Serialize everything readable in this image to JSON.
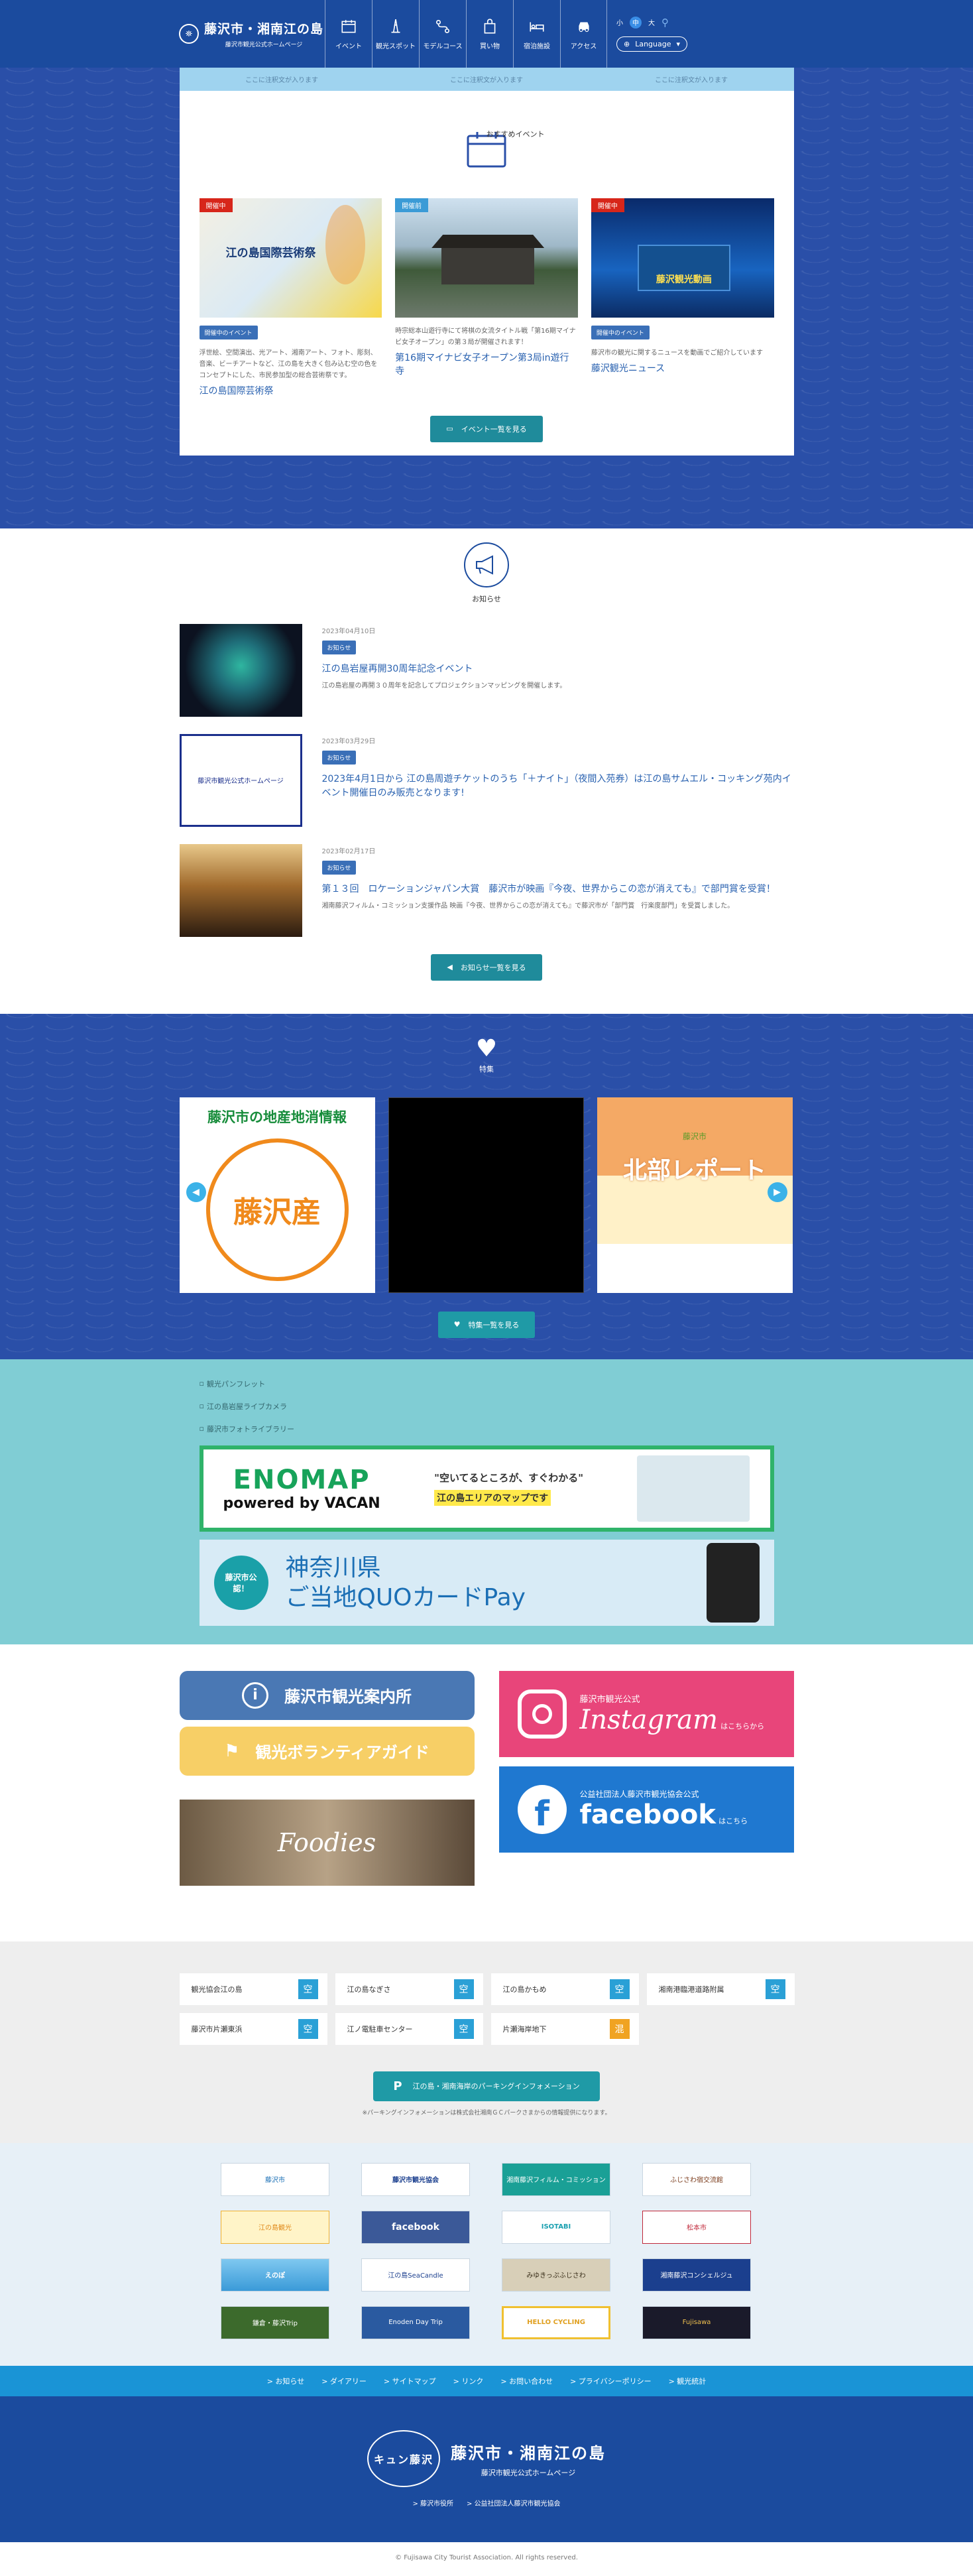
{
  "header": {
    "logo_title": "藤沢市・湘南江の島",
    "logo_sub": "藤沢市観光公式ホームページ",
    "nav": [
      {
        "label": "イベント",
        "icon": "calendar-icon"
      },
      {
        "label": "観光スポット",
        "icon": "tower-icon"
      },
      {
        "label": "モデルコース",
        "icon": "route-icon"
      },
      {
        "label": "買い物",
        "icon": "shopping-bag-icon"
      },
      {
        "label": "宿泊施設",
        "icon": "bed-icon"
      },
      {
        "label": "アクセス",
        "icon": "car-icon"
      }
    ],
    "font_sizes": [
      "小",
      "中",
      "大"
    ],
    "language_label": "Language"
  },
  "ticker": [
    "ここに注釈文が入ります",
    "ここに注釈文が入ります",
    "ここに注釈文が入ります"
  ],
  "events": {
    "title": "おすすめイベント",
    "button": "イベント一覧を見る",
    "cards": [
      {
        "badge": "開催中",
        "image_text": "江の島国際芸術祭",
        "chip": "開催中のイベント",
        "desc": "浮世絵、空間演出、光アート、湘南アート、フォト、彫刻、音楽、ビーチアートなど、江の島を大きく包み込む空の色をコンセプトにした、市民参加型の総合芸術祭です。",
        "title": "江の島国際芸術祭"
      },
      {
        "badge": "開催前",
        "image_text": "",
        "chip": "",
        "desc": "時宗総本山遊行寺にて将棋の女流タイトル戦「第16期マイナビ女子オープン」の第３局が開催されます！",
        "title": "第16期マイナビ女子オープン第3局in遊行寺"
      },
      {
        "badge": "開催中",
        "image_text": "藤沢観光動画",
        "chip": "開催中のイベント",
        "desc": "藤沢市の観光に関するニュースを動画でご紹介しています",
        "title": "藤沢観光ニュース"
      }
    ]
  },
  "news": {
    "title": "お知らせ",
    "button": "お知らせ一覧を見る",
    "items": [
      {
        "date": "2023年04月10日",
        "tag": "お知らせ",
        "title": "江の島岩屋再開30周年記念イベント",
        "body": "江の島岩屋の再開３０周年を記念してプロジェクションマッピングを開催します。"
      },
      {
        "date": "2023年03月29日",
        "tag": "お知らせ",
        "title": "2023年4月1日から 江の島周遊チケットのうち「＋ナイト」（夜間入苑券）は江の島サムエル・コッキング苑内イベント開催日のみ販売となります!",
        "body": ""
      },
      {
        "date": "2023年02月17日",
        "tag": "お知らせ",
        "title": "第１３回　ロケーションジャパン大賞　藤沢市が映画『今夜、世界からこの恋が消えても』で部門賞を受賞！",
        "body": "湘南藤沢フィルム・コミッション支援作品 映画『今夜、世界からこの恋が消えても』で藤沢市が「部門賞　行楽度部門」を受賞しました。"
      }
    ],
    "thumb2_text": "藤沢市観光公式ホームページ"
  },
  "features": {
    "title": "特集",
    "button": "特集一覧を見る",
    "items": [
      {
        "head": "藤沢市の地産地消情報",
        "main": "藤沢産"
      },
      {
        "head": "",
        "main": ""
      },
      {
        "head": "藤沢市",
        "main": "北部レポート"
      }
    ]
  },
  "banners": {
    "alts": [
      "観光パンフレット",
      "江の島岩屋ライブカメラ",
      "藤沢市フォトライブラリー"
    ],
    "enomap_title": "ENOMAP",
    "enomap_sub": "powered by VACAN",
    "enomap_copy1": "\"空いてるところが、すぐわかる\"",
    "enomap_copy2": "江の島エリアのマップです",
    "quo_badge": "藤沢市公認！",
    "quo_line1": "神奈川県",
    "quo_line2": "ご当地QUOカードPay"
  },
  "links": {
    "info_center": "藤沢市観光案内所",
    "volunteer": "観光ボランティアガイド",
    "foodies": "Foodies",
    "instagram_sub": "藤沢市観光公式",
    "instagram": "Instagram",
    "instagram_more": "はこちらから",
    "facebook_sub": "公益社団法人藤沢市観光協会公式",
    "facebook": "facebook",
    "facebook_more": "はこちら"
  },
  "status": {
    "items": [
      {
        "name": "観光協会江の島",
        "mark": "空"
      },
      {
        "name": "江の島なぎさ",
        "mark": "空"
      },
      {
        "name": "江の島かもめ",
        "mark": "空"
      },
      {
        "name": "湘南港臨港道路附属",
        "mark": "空"
      },
      {
        "name": "藤沢市片瀬東浜",
        "mark": "空"
      },
      {
        "name": "江ノ電駐車センター",
        "mark": "空"
      },
      {
        "name": "片瀬海岸地下",
        "mark": "混"
      }
    ],
    "parking_button": "江の島・湘南海岸のパーキングインフォメーション",
    "parking_note": "※パーキングインフォメーションは株式会社湘南ＧＣパークさまからの情報提供になります。"
  },
  "partners": [
    "藤沢市",
    "藤沢市観光協会",
    "湘南藤沢フィルム・コミッション",
    "ふじさわ宿交流館",
    "江の島観光",
    "facebook",
    "ISOTABI",
    "松本市",
    "えのぽ",
    "江の島SeaCandle",
    "みゆきっぷふじさわ",
    "湘南藤沢コンシェルジュ",
    "鎌倉・藤沢Trip",
    "Enoden Day Trip",
    "HELLO CYCLING",
    "Fujisawa"
  ],
  "footer": {
    "subnav": [
      "お知らせ",
      "ダイアリー",
      "サイトマップ",
      "リンク",
      "お問い合わせ",
      "プライバシーポリシー",
      "観光統計"
    ],
    "mark": "キュン藤沢",
    "title": "藤沢市・湘南江の島",
    "sub": "藤沢市観光公式ホームページ",
    "links": [
      "藤沢市役所",
      "公益社団法人藤沢市観光協会"
    ],
    "copyright": "© Fujisawa City Tourist Association. All rights reserved."
  }
}
